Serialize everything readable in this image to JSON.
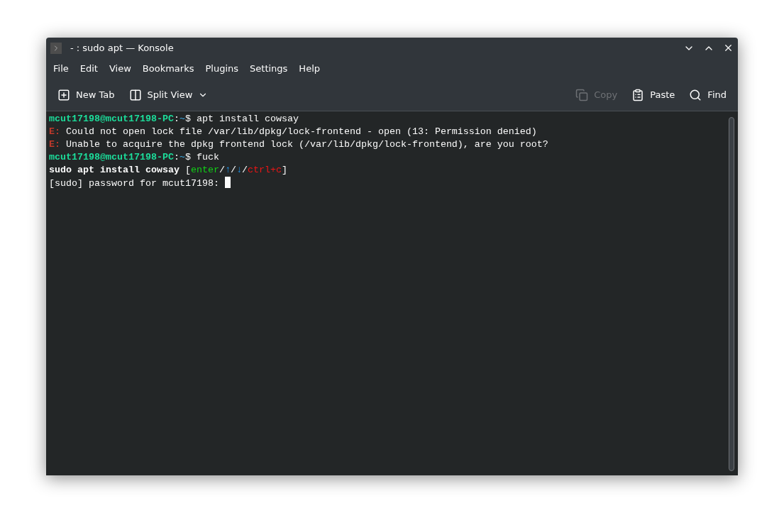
{
  "window": {
    "title": "- : sudo apt — Konsole"
  },
  "menu": [
    "File",
    "Edit",
    "View",
    "Bookmarks",
    "Plugins",
    "Settings",
    "Help"
  ],
  "toolbar": {
    "left": [
      {
        "label": "New Tab",
        "kind": "newtab",
        "disabled": false
      },
      {
        "label": "Split View",
        "kind": "split",
        "disabled": false
      }
    ],
    "right": [
      {
        "label": "Copy",
        "kind": "copy",
        "disabled": true
      },
      {
        "label": "Paste",
        "kind": "paste",
        "disabled": false
      },
      {
        "label": "Find",
        "kind": "find",
        "disabled": false
      }
    ]
  },
  "terminal": {
    "lines": [
      [
        {
          "text": "mcut17198@mcut17198-PC",
          "kind": "prompt"
        },
        {
          "text": ":",
          "kind": "plain"
        },
        {
          "text": "~",
          "kind": "path"
        },
        {
          "text": "$ apt install cowsay",
          "kind": "plain"
        }
      ],
      [
        {
          "text": "E:",
          "kind": "error"
        },
        {
          "text": " Could not open lock file /var/lib/dpkg/lock-frontend - open (13: Permission denied)",
          "kind": "plain"
        }
      ],
      [
        {
          "text": "E:",
          "kind": "error"
        },
        {
          "text": " Unable to acquire the dpkg frontend lock (/var/lib/dpkg/lock-frontend), are you root?",
          "kind": "plain"
        }
      ],
      [
        {
          "text": "mcut17198@mcut17198-PC",
          "kind": "prompt"
        },
        {
          "text": ":",
          "kind": "plain"
        },
        {
          "text": "~",
          "kind": "path"
        },
        {
          "text": "$ fuck",
          "kind": "plain"
        }
      ],
      [
        {
          "text": "sudo apt install cowsay",
          "kind": "strong"
        },
        {
          "text": " [",
          "kind": "plain"
        },
        {
          "text": "enter",
          "kind": "confirm"
        },
        {
          "text": "/",
          "kind": "plain"
        },
        {
          "text": "↑",
          "kind": "nav"
        },
        {
          "text": "/",
          "kind": "plain"
        },
        {
          "text": "↓",
          "kind": "nav"
        },
        {
          "text": "/",
          "kind": "plain"
        },
        {
          "text": "ctrl+c",
          "kind": "cancel"
        },
        {
          "text": "]",
          "kind": "plain"
        }
      ],
      [
        {
          "text": "[sudo] password for mcut17198: ",
          "kind": "plain"
        }
      ]
    ],
    "cursor": true
  }
}
